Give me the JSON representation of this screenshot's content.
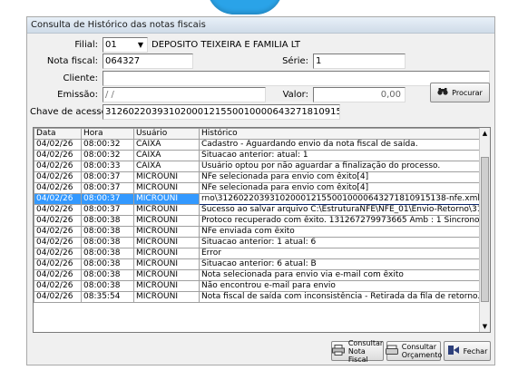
{
  "window": {
    "title": "Consulta de Histórico das notas fiscais"
  },
  "form": {
    "filial_label": "Filial:",
    "filial_code": "01",
    "filial_name": "DEPOSITO TEIXEIRA E FAMILIA LT",
    "nota_label": "Nota fiscal:",
    "nota_value": "064327",
    "serie_label": "Série:",
    "serie_value": "1",
    "cliente_label": "Cliente:",
    "cliente_value": "",
    "emissao_label": "Emissão:",
    "emissao_value": " / /",
    "valor_label": "Valor:",
    "valor_value": "0,00",
    "chave_label": "Chave de acesso:",
    "chave_value": "31260220393102000121550010000643271810915138",
    "procurar_label": "Procurar"
  },
  "grid": {
    "headers": [
      "Data",
      "Hora",
      "Usuário",
      "Histórico"
    ],
    "rows": [
      [
        "04/02/26",
        "08:00:32",
        "CAIXA",
        "Cadastro - Aguardando envio da nota fiscal de saída."
      ],
      [
        "04/02/26",
        "08:00:32",
        "CAIXA",
        "Situacao anterior:   atual: 1"
      ],
      [
        "04/02/26",
        "08:00:33",
        "CAIXA",
        "Usuário optou por não aguardar a finalização do processo."
      ],
      [
        "04/02/26",
        "08:00:37",
        "MICROUNI",
        "NFe selecionada para envio com êxito[4]"
      ],
      [
        "04/02/26",
        "08:00:37",
        "MICROUNI",
        "NFe selecionada para envio com êxito[4]"
      ],
      [
        "04/02/26",
        "08:00:37",
        "MICROUNI",
        "rno\\31260220393102000121550010000643271810915138-nfe.xml"
      ],
      [
        "04/02/26",
        "08:00:37",
        "MICROUNI",
        "Sucesso ao salvar arquivo C:\\EstruturaNFE\\NFE_01\\Envio-Retorno\\3126"
      ],
      [
        "04/02/26",
        "08:00:38",
        "MICROUNI",
        "Protoco recuperado com êxito.  131267279973665 Amb :  1 Sincrono"
      ],
      [
        "04/02/26",
        "08:00:38",
        "MICROUNI",
        "NFe enviada com êxito"
      ],
      [
        "04/02/26",
        "08:00:38",
        "MICROUNI",
        "Situacao anterior: 1  atual: 6"
      ],
      [
        "04/02/26",
        "08:00:38",
        "MICROUNI",
        "Error"
      ],
      [
        "04/02/26",
        "08:00:38",
        "MICROUNI",
        "Situacao anterior: 6  atual: B"
      ],
      [
        "04/02/26",
        "08:00:38",
        "MICROUNI",
        "Nota selecionada para envio via e-mail com êxito"
      ],
      [
        "04/02/26",
        "08:00:38",
        "MICROUNI",
        "Não encontrou e-mail para envio"
      ],
      [
        "04/02/26",
        "08:35:54",
        "MICROUNI",
        "Nota fiscal de saída com inconsistência - Retirada da fila de retorno."
      ]
    ],
    "selected_row": 5
  },
  "footer": {
    "consultar_nota_line1": "Consultar",
    "consultar_nota_line2": "Nota Fiscal",
    "consultar_orc_line1": "Consultar",
    "consultar_orc_line2": "Orçamento",
    "fechar_label": "Fechar"
  },
  "colors": {
    "selection": "#3399ff",
    "accent_arc": "#2aa3e8"
  },
  "icons": [
    "binoculars-icon",
    "printer-icon",
    "document-icon",
    "door-exit-icon",
    "chevron-down-icon",
    "scroll-up-icon",
    "scroll-down-icon"
  ]
}
